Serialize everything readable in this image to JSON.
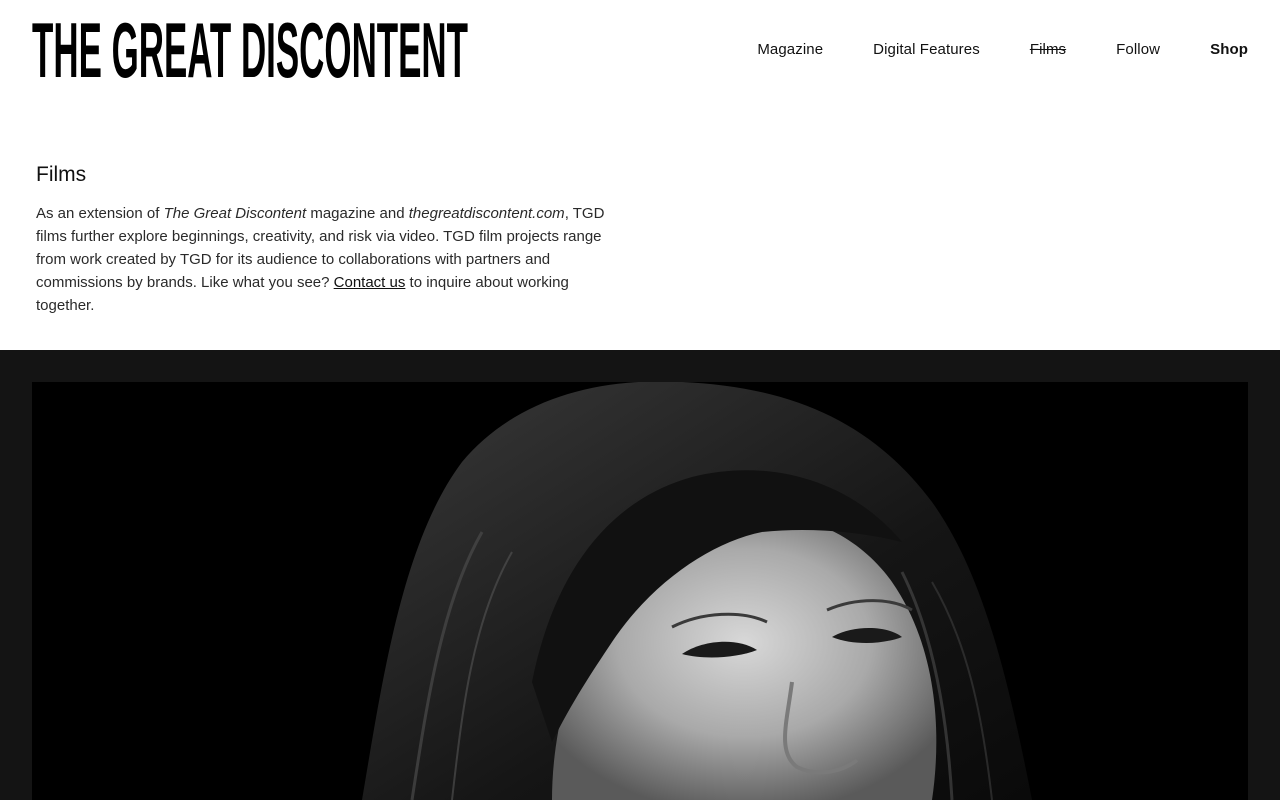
{
  "site": {
    "logo_text": "THE GREAT DISCONTENT"
  },
  "nav": {
    "items": [
      {
        "label": "Magazine"
      },
      {
        "label": "Digital Features"
      },
      {
        "label": "Films"
      },
      {
        "label": "Follow"
      },
      {
        "label": "Shop"
      }
    ]
  },
  "intro": {
    "title": "Films",
    "text_1": "As an extension of ",
    "em_1": "The Great Discontent",
    "text_2": " magazine and ",
    "em_2": "thegreatdiscontent.com",
    "text_3": ", TGD films further explore beginnings, creativity, and risk via video. TGD film projects range from work created by TGD for its audience to collaborations with partners and commissions by brands. Like what you see? ",
    "link": "Contact us",
    "text_4": " to inquire about working together."
  },
  "colors": {
    "section_bg": "#141414",
    "frame_bg": "#000000"
  }
}
